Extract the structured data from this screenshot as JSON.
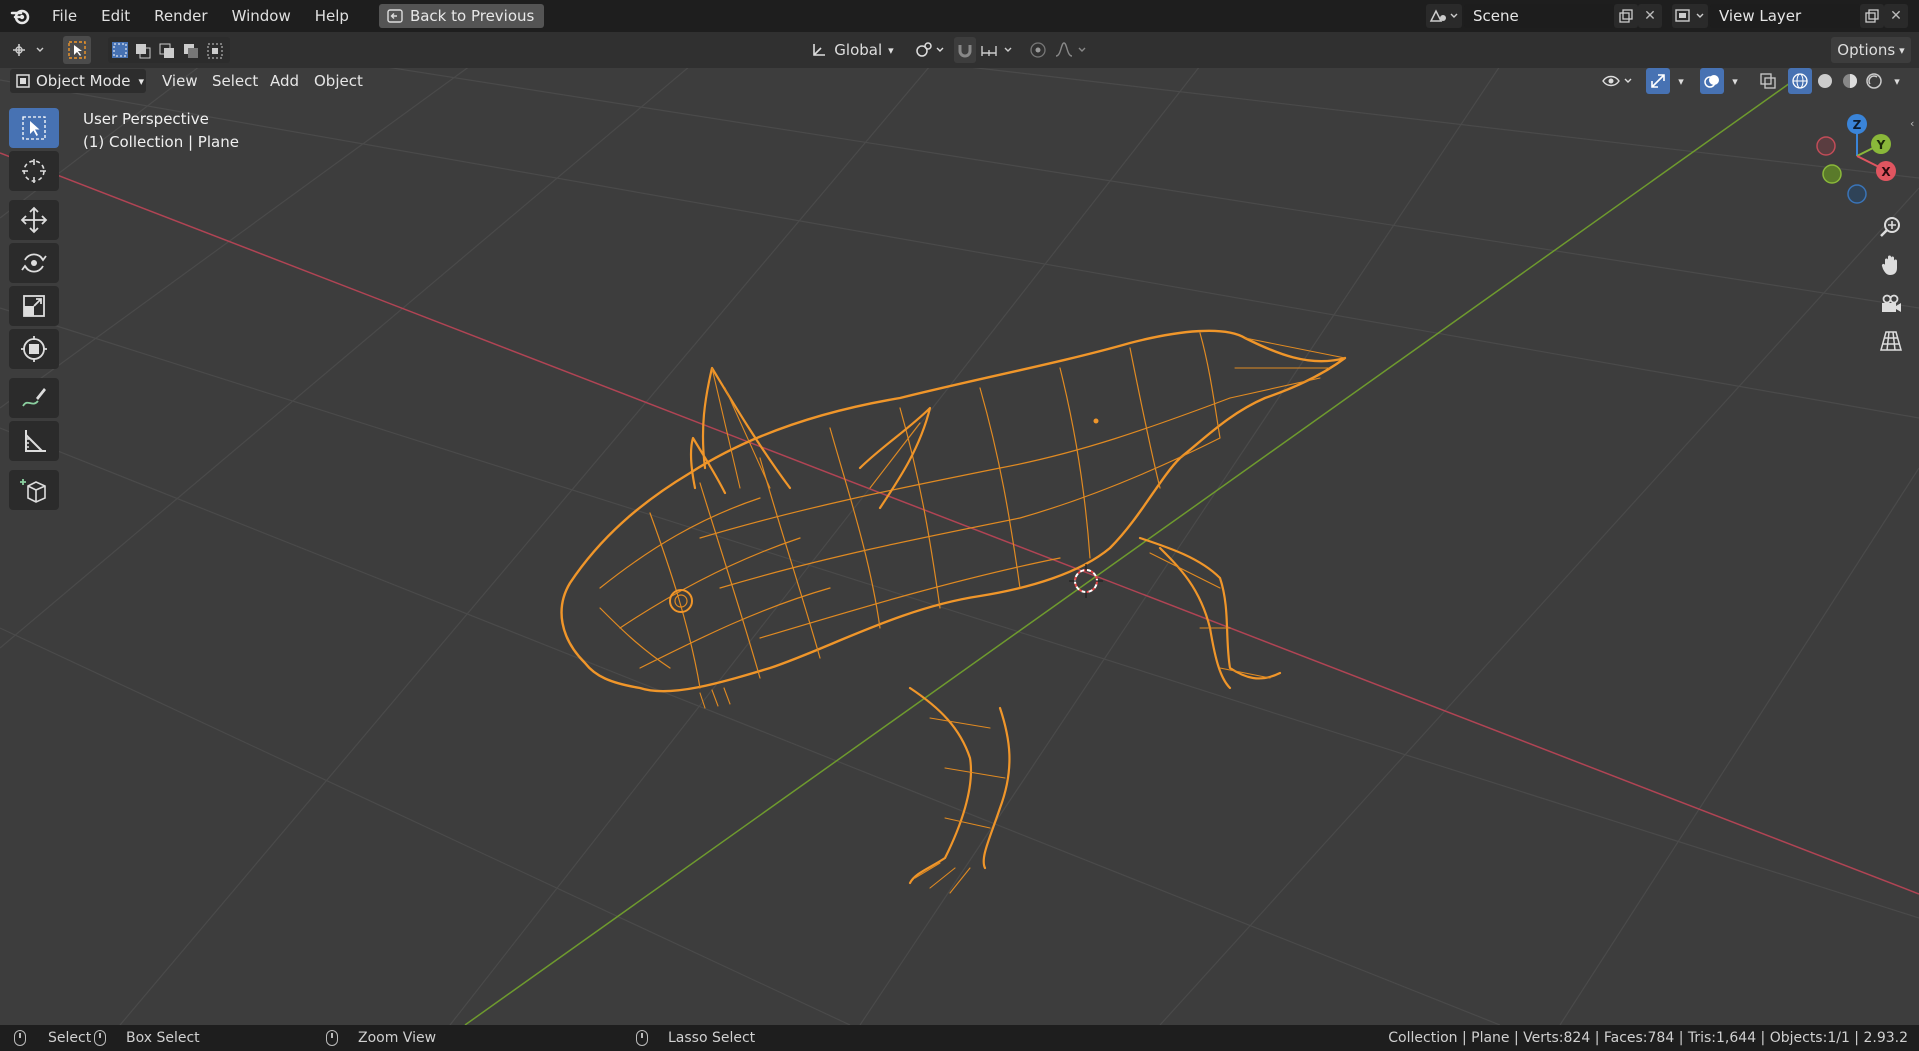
{
  "topbar": {
    "menus": [
      "File",
      "Edit",
      "Render",
      "Window",
      "Help"
    ],
    "back_button": "Back to Previous",
    "scene_name": "Scene",
    "view_layer_name": "View Layer"
  },
  "toolheader": {
    "transform_orientation": "Global",
    "options_label": "Options"
  },
  "viewport_header": {
    "mode": "Object Mode",
    "menus": [
      "View",
      "Select",
      "Add",
      "Object"
    ]
  },
  "overlay": {
    "view_name": "User Perspective",
    "collection_info": "(1) Collection | Plane"
  },
  "gizmo": {
    "z_label": "Z",
    "y_label": "Y",
    "x_label": "X"
  },
  "statusbar": {
    "select": "Select",
    "box_select": "Box Select",
    "zoom_view": "Zoom View",
    "lasso_select": "Lasso Select",
    "scene_stats": "Collection | Plane | Verts:824 | Faces:784 | Tris:1,644 | Objects:1/1 | 2.93.2"
  },
  "colors": {
    "background": "#3d3d3d",
    "grid": "#474747",
    "x_axis": "#b04454",
    "y_axis": "#6e9a2e",
    "selection_outline": "#f0962a",
    "wire": "#e08a22",
    "active_tool": "#4772b3"
  }
}
